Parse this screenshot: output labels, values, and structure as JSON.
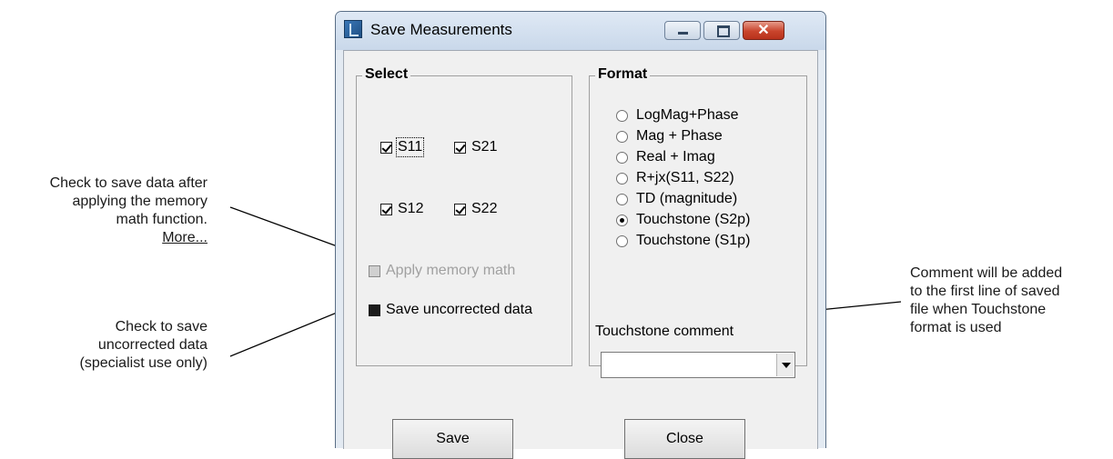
{
  "window": {
    "title": "Save Measurements",
    "close_glyph": "✕"
  },
  "select_group": {
    "legend": "Select",
    "checkboxes": [
      {
        "label": "S11",
        "checked": true
      },
      {
        "label": "S21",
        "checked": true
      },
      {
        "label": "S12",
        "checked": true
      },
      {
        "label": "S22",
        "checked": true
      }
    ],
    "apply_memory_math": {
      "label": "Apply memory math",
      "enabled": false
    },
    "save_uncorrected": {
      "label": "Save uncorrected data",
      "checked": false
    }
  },
  "format_group": {
    "legend": "Format",
    "options": [
      {
        "label": "LogMag+Phase",
        "selected": false
      },
      {
        "label": "Mag + Phase",
        "selected": false
      },
      {
        "label": "Real + Imag",
        "selected": false
      },
      {
        "label": "R+jx(S11, S22)",
        "selected": false
      },
      {
        "label": "TD (magnitude)",
        "selected": false
      },
      {
        "label": "Touchstone (S2p)",
        "selected": true
      },
      {
        "label": "Touchstone (S1p)",
        "selected": false
      }
    ],
    "touchstone_comment_label": "Touchstone  comment",
    "touchstone_comment_value": ""
  },
  "buttons": {
    "save": "Save",
    "close": "Close"
  },
  "annotations": {
    "memory_math": [
      "Check to save data after",
      "applying the memory",
      "math function."
    ],
    "more_link": "More...",
    "uncorrected": [
      "Check to save",
      "uncorrected data",
      "(specialist use only)"
    ],
    "comment": [
      "Comment will be added",
      "to the first line of saved",
      "file when Touchstone",
      "format is used"
    ]
  },
  "colors": {
    "close_button": "#c9442c",
    "titlebar": "#c9d8ea"
  }
}
